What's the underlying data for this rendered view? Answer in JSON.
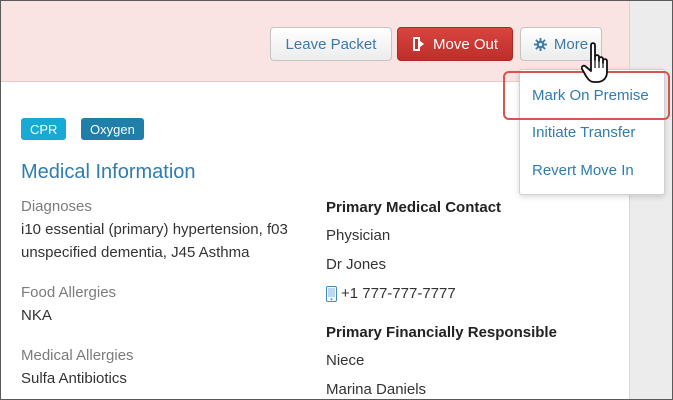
{
  "header": {
    "buttons": {
      "leave_packet": "Leave Packet",
      "move_out": "Move Out",
      "more": "More"
    }
  },
  "more_menu": {
    "items": [
      "Mark On Premise",
      "Initiate Transfer",
      "Revert Move In"
    ],
    "highlighted_index": 0
  },
  "tags": [
    {
      "label": "CPR",
      "color": "#19a9d5"
    },
    {
      "label": "Oxygen",
      "color": "#1f7fa9"
    }
  ],
  "medical": {
    "title": "Medical Information",
    "diagnoses_label": "Diagnoses",
    "diagnoses_value": "i10 essential (primary) hypertension, f03 unspecified dementia, J45 Asthma",
    "food_allergies_label": "Food Allergies",
    "food_allergies_value": "NKA",
    "medical_allergies_label": "Medical Allergies",
    "medical_allergies_value": "Sulfa Antibiotics"
  },
  "primary_medical_contact": {
    "heading": "Primary Medical Contact",
    "relation": "Physician",
    "name": "Dr Jones",
    "phone": "+1 777-777-7777"
  },
  "primary_financial": {
    "heading": "Primary Financially Responsible",
    "relation": "Niece",
    "name": "Marina Daniels"
  },
  "colors": {
    "header_band": "#f9e3e3",
    "link_blue": "#2f7db0",
    "danger_red": "#c9302c",
    "highlight_red": "#d9534f"
  },
  "icons": {
    "move_out": "exit-door-icon",
    "more": "gear-icon",
    "phone": "mobile-phone-icon",
    "cursor": "hand-pointer-icon"
  }
}
